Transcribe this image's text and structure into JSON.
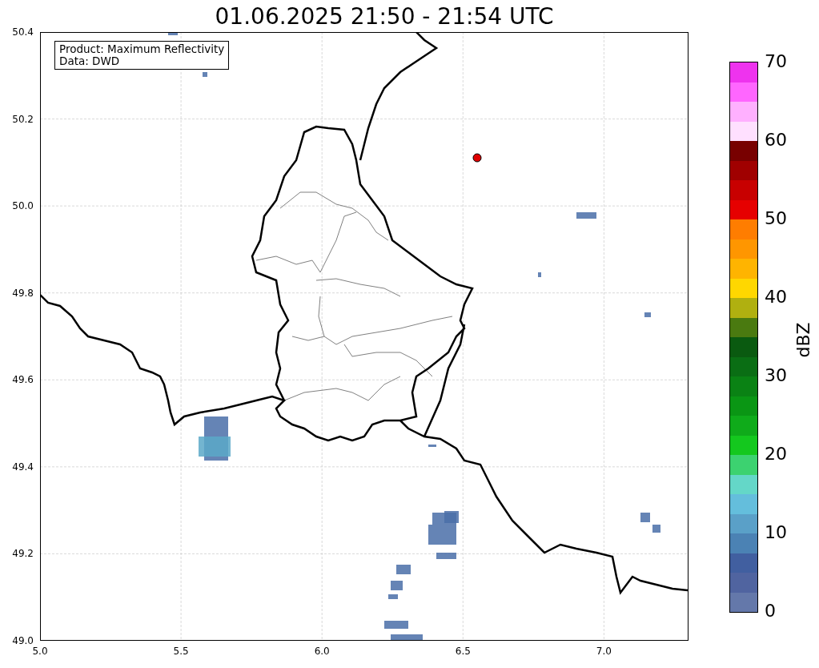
{
  "title": "01.06.2025 21:50 - 21:54 UTC",
  "map": {
    "info_lines": [
      "Product: Maximum Reflectivity",
      "Data: DWD"
    ],
    "y_tick_labels": [
      "50.4",
      "50.2",
      "50.0",
      "49.8",
      "49.6",
      "49.4",
      "49.2",
      "49.0"
    ],
    "x_tick_labels": [
      "5.0",
      "5.5",
      "6.0",
      "6.5",
      "7.0"
    ]
  },
  "colorbar": {
    "label": "dBZ",
    "tick_labels": [
      "70",
      "60",
      "50",
      "40",
      "30",
      "20",
      "10",
      "0"
    ],
    "bins": [
      {
        "color": "#ee33ee"
      },
      {
        "color": "#ff66ff"
      },
      {
        "color": "#ffb0ff"
      },
      {
        "color": "#ffe0ff"
      },
      {
        "color": "#780000"
      },
      {
        "color": "#a00000"
      },
      {
        "color": "#c80000"
      },
      {
        "color": "#e60000"
      },
      {
        "color": "#ff7d00"
      },
      {
        "color": "#ff9600"
      },
      {
        "color": "#ffb400"
      },
      {
        "color": "#ffd700"
      },
      {
        "color": "#b0b010"
      },
      {
        "color": "#4a7a10"
      },
      {
        "color": "#0a5a10"
      },
      {
        "color": "#0a6e14"
      },
      {
        "color": "#0a8214"
      },
      {
        "color": "#0a9614"
      },
      {
        "color": "#0fab1a"
      },
      {
        "color": "#14c81e"
      },
      {
        "color": "#3cd270"
      },
      {
        "color": "#64d7c8"
      },
      {
        "color": "#64bedc"
      },
      {
        "color": "#5aa0c8"
      },
      {
        "color": "#4b82b4"
      },
      {
        "color": "#415fa0"
      },
      {
        "color": "#5064a0"
      },
      {
        "color": "#6478aa"
      }
    ]
  }
}
